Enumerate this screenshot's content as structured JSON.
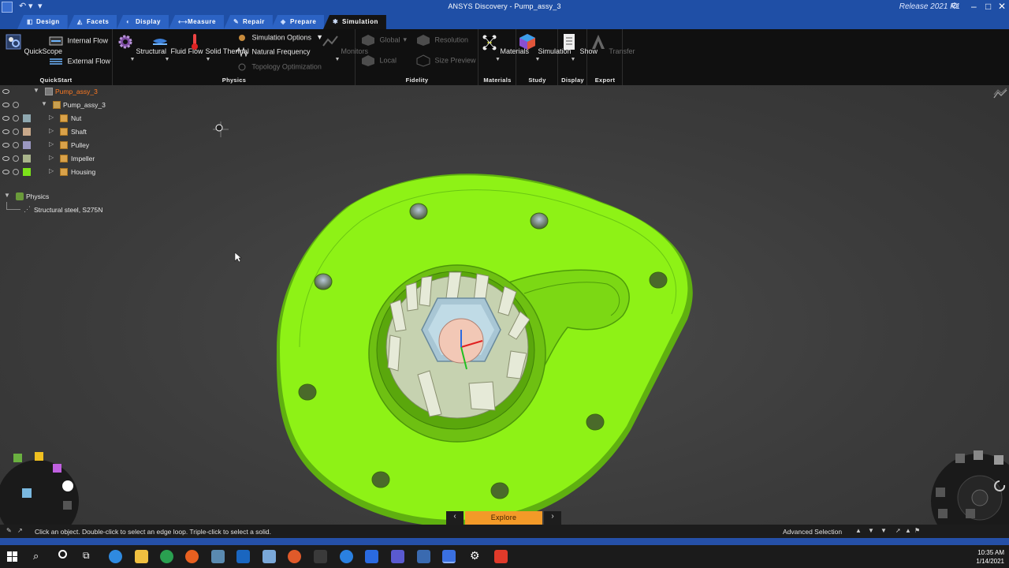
{
  "app": {
    "title": "ANSYS Discovery - Pump_assy_3",
    "release": "Release 2021 R1"
  },
  "tabs": [
    {
      "label": "Design",
      "icon": "design-icon"
    },
    {
      "label": "Facets",
      "icon": "facets-icon"
    },
    {
      "label": "Display",
      "icon": "display-icon"
    },
    {
      "label": "Measure",
      "icon": "measure-icon"
    },
    {
      "label": "Repair",
      "icon": "repair-icon"
    },
    {
      "label": "Prepare",
      "icon": "prepare-icon"
    },
    {
      "label": "Simulation",
      "icon": "simulation-icon",
      "active": true
    }
  ],
  "ribbon": {
    "quickstart": {
      "label": "QuickStart",
      "quickscope": "QuickScope",
      "internal_flow": "Internal Flow",
      "external_flow": "External Flow"
    },
    "physics": {
      "label": "Physics",
      "structural": "Structural",
      "fluid_flow": "Fluid Flow",
      "solid_thermal": "Solid Thermal",
      "simulation_options": "Simulation Options",
      "natural_frequency": "Natural Frequency",
      "topology_optimization": "Topology Optimization",
      "monitors": "Monitors"
    },
    "fidelity": {
      "label": "Fidelity",
      "global": "Global",
      "local": "Local",
      "resolution": "Resolution",
      "size_preview": "Size Preview"
    },
    "materials": {
      "label": "Materials",
      "button": "Materials"
    },
    "study": {
      "label": "Study",
      "button": "Simulation"
    },
    "display": {
      "label": "Display",
      "button": "Show"
    },
    "export": {
      "label": "Export",
      "button": "Transfer"
    }
  },
  "tree": {
    "root": "Pump_assy_3",
    "assembly": "Pump_assy_3",
    "parts": [
      {
        "label": "Nut",
        "color": "#8fa8b0"
      },
      {
        "label": "Shaft",
        "color": "#c8a88a"
      },
      {
        "label": "Pulley",
        "color": "#9a97c0"
      },
      {
        "label": "Impeller",
        "color": "#a8b48a"
      },
      {
        "label": "Housing",
        "color": "#7be21a"
      }
    ],
    "physics": "Physics",
    "material": "Structural steel, S275N"
  },
  "explore": {
    "label": "Explore"
  },
  "status": {
    "message": "Click an object. Double-click to select an edge loop. Triple-click to select a solid.",
    "selection_mode": "Advanced Selection"
  },
  "clock": {
    "time": "10:35 AM",
    "date": "1/14/2021"
  },
  "colors": {
    "housing": "#8ef216",
    "accent": "#f39a28",
    "titlebar": "#1f4fa6"
  }
}
